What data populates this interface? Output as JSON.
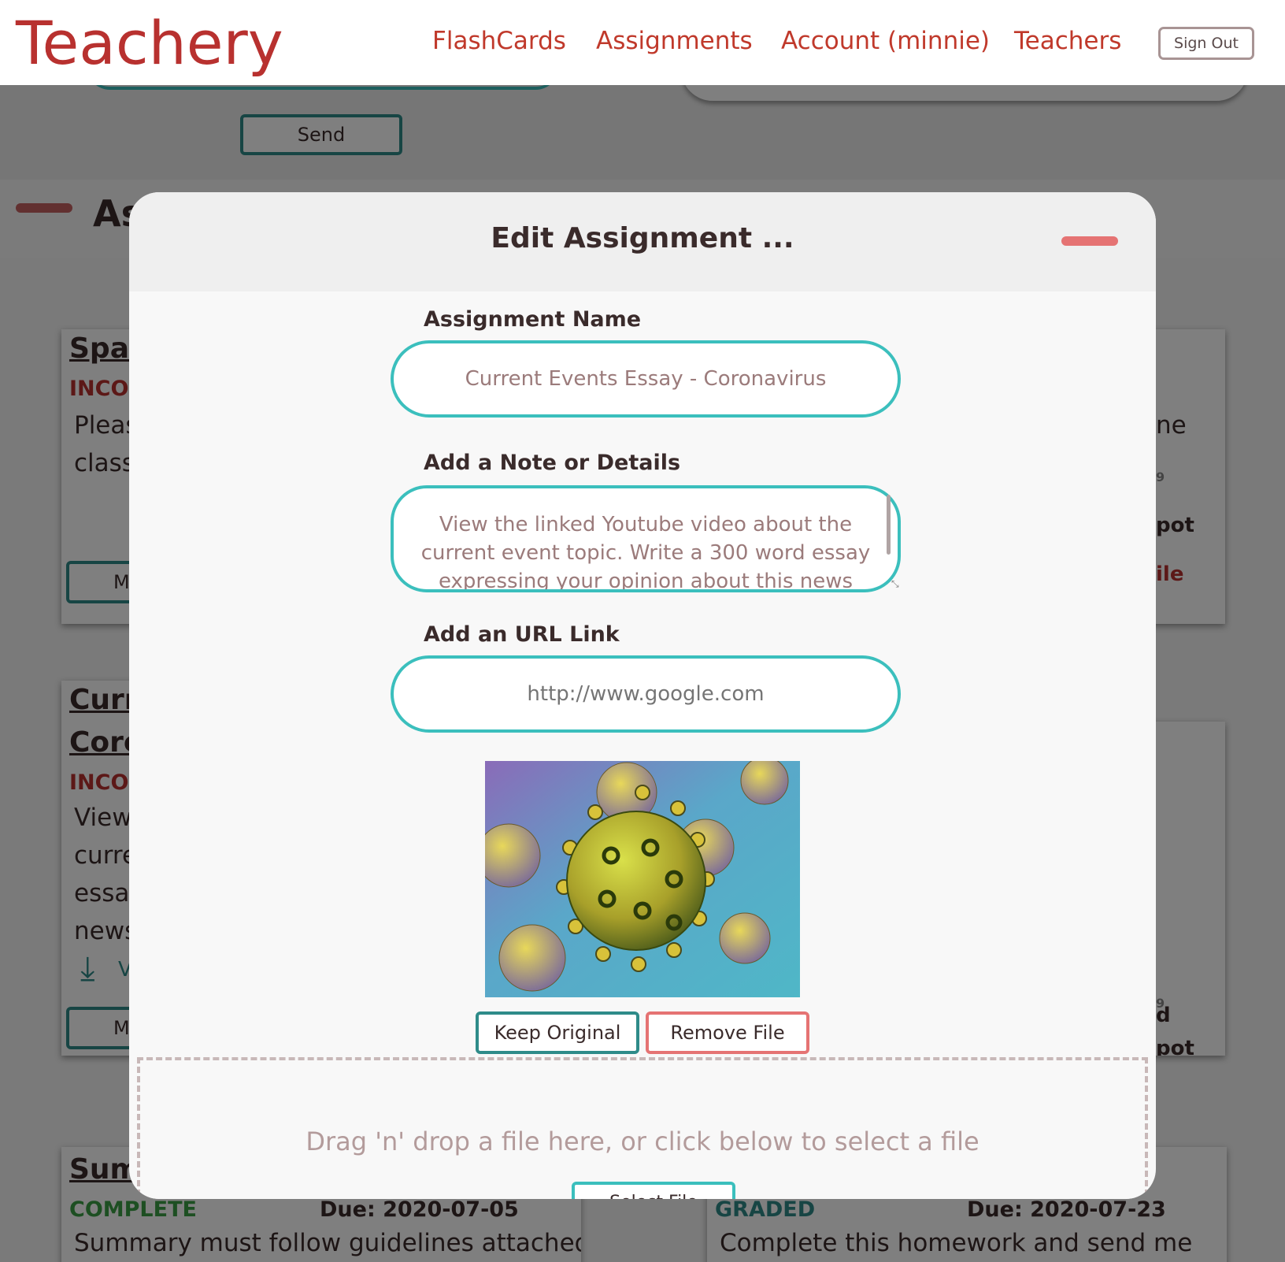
{
  "nav": {
    "brand": "Teachery",
    "links": [
      "FlashCards",
      "Assignments",
      "Account (minnie)",
      "Teachers"
    ],
    "sign_out": "Sign Out"
  },
  "background": {
    "send_label": "Send",
    "section_title": "As",
    "cards": [
      {
        "title": "Spar",
        "status": "INCO",
        "desc_lines": [
          "Pleas",
          "class"
        ],
        "button": "M"
      },
      {
        "title_lines": [
          "Curr",
          "Corc"
        ],
        "status": "INCO",
        "desc_lines": [
          "View",
          "curre",
          "essay",
          "news"
        ],
        "link_label": "V",
        "button": "M"
      },
      {
        "title": "Sum",
        "status": "COMPLETE",
        "due": "Due: 2020-07-05",
        "desc": "Summary must follow guidelines attached"
      },
      {
        "status": "GRADED",
        "due": "Due: 2020-07-23",
        "desc": "Complete this homework and send me"
      }
    ],
    "right_fragments": {
      "card1": [
        "ne",
        "9",
        "pot",
        "ile"
      ],
      "card2": [
        "9",
        "pot",
        "d"
      ]
    }
  },
  "modal": {
    "title": "Edit Assignment ...",
    "name_label": "Assignment Name",
    "name_value": "Current Events Essay - Coronavirus",
    "note_label": "Add a Note or Details",
    "note_value": "View the linked Youtube video about the current event topic.  Write a 300 word essay expressing your opinion about this news topic.",
    "url_label": "Add an URL Link",
    "url_placeholder": "http://www.google.com",
    "keep_label": "Keep Original",
    "remove_label": "Remove File",
    "drop_text": "Drag 'n' drop a file here, or click below to select a file",
    "select_label": "Select File"
  },
  "colors": {
    "brand": "#b8312f",
    "teal": "#3bbfbd",
    "dark_teal": "#2e8b89",
    "remove_red": "#e57373"
  }
}
